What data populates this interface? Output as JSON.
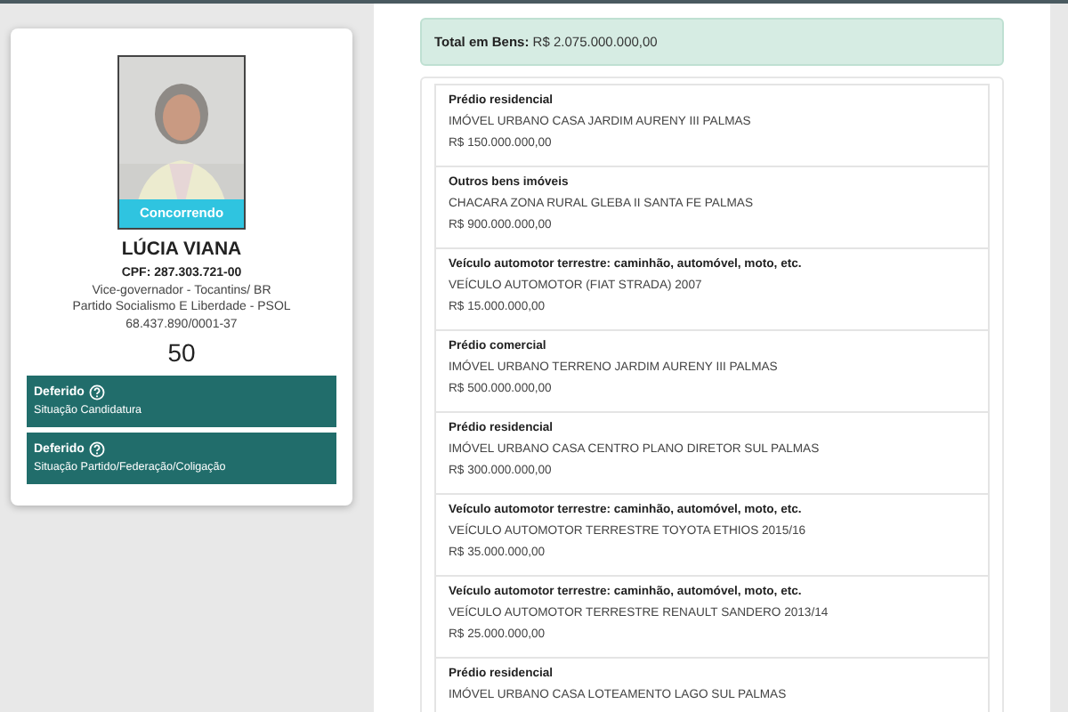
{
  "candidate": {
    "status_badge": "Concorrendo",
    "name": "LÚCIA VIANA",
    "cpf": "CPF: 287.303.721-00",
    "office": "Vice-governador - Tocantins/ BR",
    "party": "Partido Socialismo E Liberdade - PSOL",
    "cnpj": "68.437.890/0001-37",
    "number": "50",
    "situations": [
      {
        "status": "Deferido",
        "label": "Situação Candidatura"
      },
      {
        "status": "Deferido",
        "label": "Situação Partido/Federação/Coligação"
      }
    ]
  },
  "assets": {
    "total_label": "Total em Bens:",
    "total_value": "R$ 2.075.000.000,00",
    "items": [
      {
        "type": "Prédio residencial",
        "description": "IMÓVEL URBANO CASA JARDIM AURENY III PALMAS",
        "value": "R$ 150.000.000,00"
      },
      {
        "type": "Outros bens imóveis",
        "description": "CHACARA ZONA RURAL GLEBA II SANTA FE PALMAS",
        "value": "R$ 900.000.000,00"
      },
      {
        "type": "Veículo automotor terrestre: caminhão, automóvel, moto, etc.",
        "description": "VEÍCULO AUTOMOTOR (FIAT STRADA) 2007",
        "value": "R$ 15.000.000,00"
      },
      {
        "type": "Prédio comercial",
        "description": "IMÓVEL URBANO TERRENO JARDIM AURENY III PALMAS",
        "value": "R$ 500.000.000,00"
      },
      {
        "type": "Prédio residencial",
        "description": "IMÓVEL URBANO CASA CENTRO PLANO DIRETOR SUL PALMAS",
        "value": "R$ 300.000.000,00"
      },
      {
        "type": "Veículo automotor terrestre: caminhão, automóvel, moto, etc.",
        "description": "VEÍCULO AUTOMOTOR TERRESTRE TOYOTA ETHIOS 2015/16",
        "value": "R$ 35.000.000,00"
      },
      {
        "type": "Veículo automotor terrestre: caminhão, automóvel, moto, etc.",
        "description": "VEÍCULO AUTOMOTOR TERRESTRE RENAULT SANDERO 2013/14",
        "value": "R$ 25.000.000,00"
      },
      {
        "type": "Prédio residencial",
        "description": "IMÓVEL URBANO CASA LOTEAMENTO LAGO SUL PALMAS"
      }
    ]
  }
}
